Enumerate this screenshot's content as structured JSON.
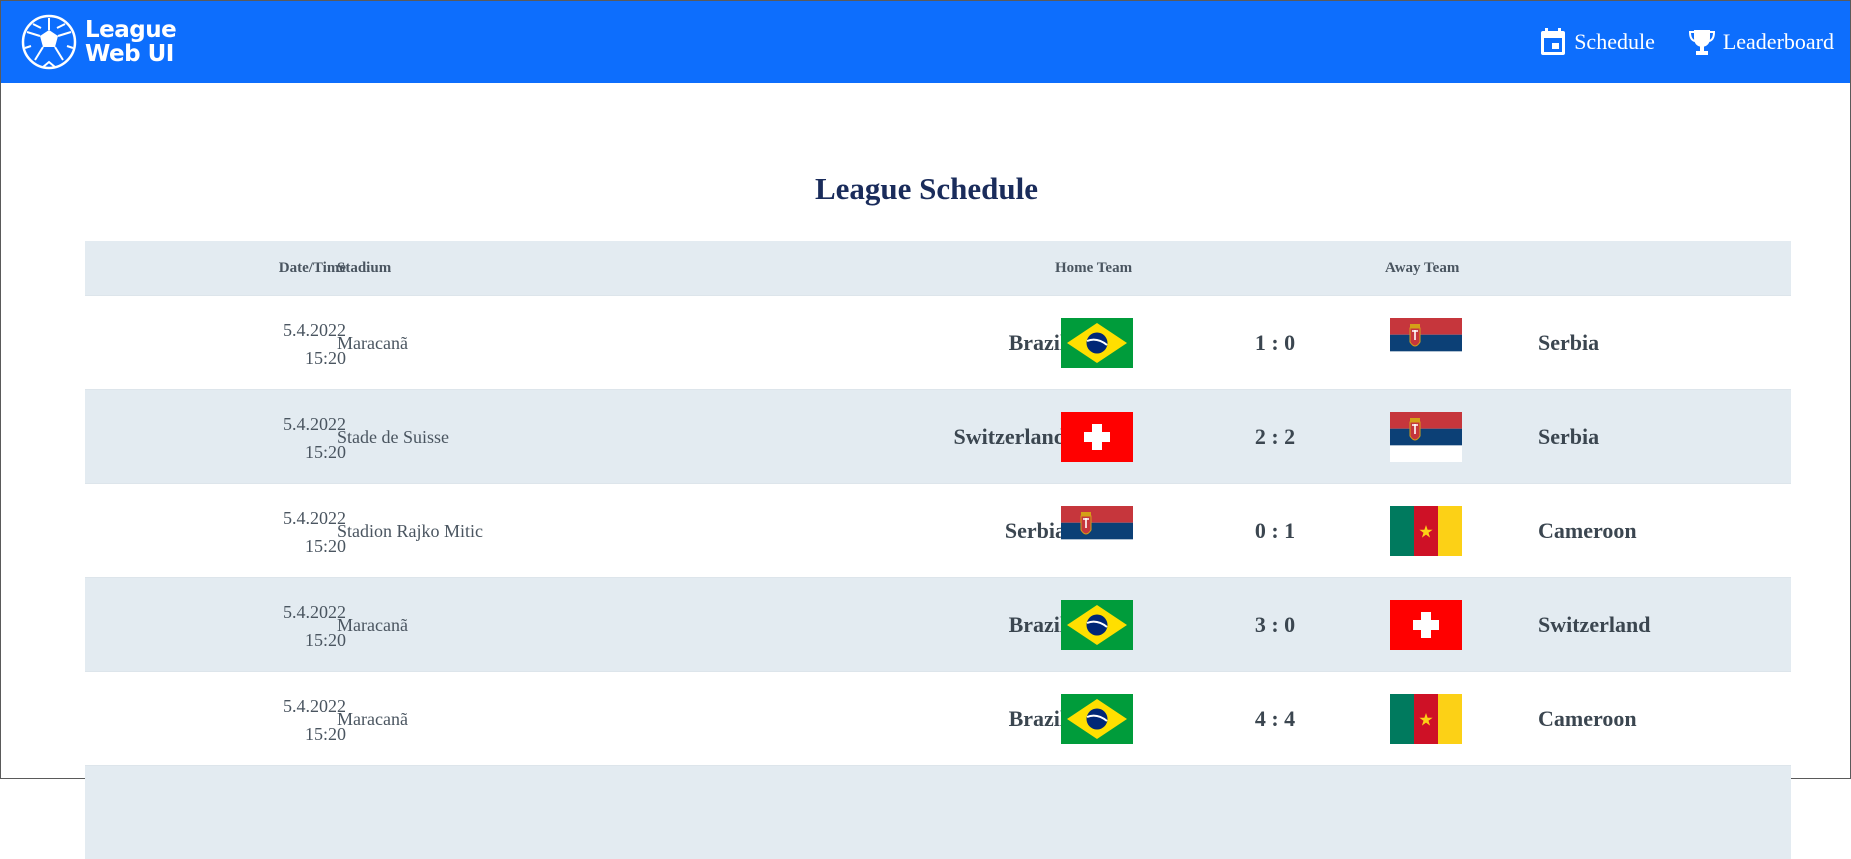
{
  "header": {
    "brand_line1": "League",
    "brand_line2": "Web UI",
    "nav": [
      {
        "label": "Schedule",
        "icon": "calendar-icon"
      },
      {
        "label": "Leaderboard",
        "icon": "trophy-icon"
      }
    ],
    "background": "#0d6efd"
  },
  "page": {
    "title": "League Schedule"
  },
  "table": {
    "columns": {
      "date": "Date/Time",
      "stadium": "Stadium",
      "home": "Home Team",
      "away": "Away Team"
    },
    "rows": [
      {
        "date": "5.4.2022",
        "time": "15:20",
        "stadium": "Maracanã",
        "home": "Brazil",
        "home_flag": "brazil-flag-icon",
        "score": "1 : 0",
        "away": "Serbia",
        "away_flag": "serbia-flag-icon"
      },
      {
        "date": "5.4.2022",
        "time": "15:20",
        "stadium": "Stade de Suisse",
        "home": "Switzerland",
        "home_flag": "switzerland-flag-icon",
        "score": "2 : 2",
        "away": "Serbia",
        "away_flag": "serbia-flag-icon"
      },
      {
        "date": "5.4.2022",
        "time": "15:20",
        "stadium": "Stadion Rajko Mitic",
        "home": "Serbia",
        "home_flag": "serbia-flag-icon",
        "score": "0 : 1",
        "away": "Cameroon",
        "away_flag": "cameroon-flag-icon"
      },
      {
        "date": "5.4.2022",
        "time": "15:20",
        "stadium": "Maracanã",
        "home": "Brazil",
        "home_flag": "brazil-flag-icon",
        "score": "3 : 0",
        "away": "Switzerland",
        "away_flag": "switzerland-flag-icon"
      },
      {
        "date": "5.4.2022",
        "time": "15:20",
        "stadium": "Maracanã",
        "home": "Brazil",
        "home_flag": "brazil-flag-icon",
        "score": "4 : 4",
        "away": "Cameroon",
        "away_flag": "cameroon-flag-icon"
      }
    ]
  }
}
